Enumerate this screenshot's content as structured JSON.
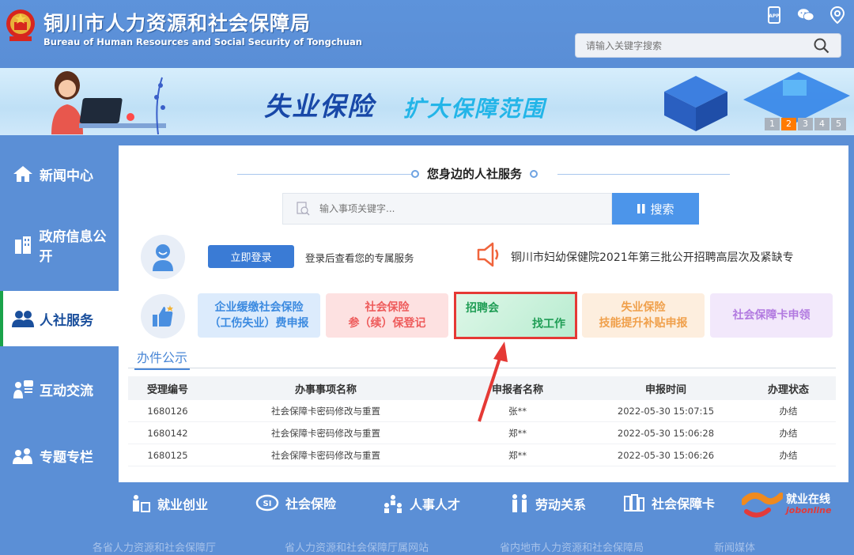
{
  "header": {
    "title": "铜川市人力资源和社会保障局",
    "subtitle": "Bureau of Human Resources and Social Security of Tongchuan",
    "icons": [
      "app-icon",
      "wechat-icon",
      "location-icon"
    ],
    "app_label": "APP",
    "search_placeholder": "请输入关键字搜索"
  },
  "banner": {
    "title": "失业保险",
    "subtitle": "扩大保障范围",
    "pages": [
      "1",
      "2",
      "3",
      "4",
      "5"
    ],
    "active_page": "2"
  },
  "sidebar": {
    "items": [
      {
        "label": "新闻中心",
        "icon": "home-icon"
      },
      {
        "label": "政府信息公开",
        "icon": "building-icon"
      },
      {
        "label": "人社服务",
        "icon": "people-icon"
      },
      {
        "label": "互动交流",
        "icon": "chat-person-icon"
      },
      {
        "label": "专题专栏",
        "icon": "group-icon"
      }
    ],
    "active": "人社服务"
  },
  "services": {
    "title": "您身边的人社服务",
    "search_placeholder": "输入事项关键字...",
    "search_button": "搜索",
    "login_button": "立即登录",
    "login_tip": "登录后查看您的专属服务",
    "notice": "铜川市妇幼保健院2021年第三批公开招聘高层次及紧缺专",
    "cards": [
      {
        "line1": "企业缓缴社会保险",
        "line2": "（工伤失业）费申报"
      },
      {
        "line1": "社会保险",
        "line2": "参（续）保登记"
      },
      {
        "line1": "招聘会",
        "line2": "找工作"
      },
      {
        "line1": "失业保险",
        "line2": "技能提升补贴申报"
      },
      {
        "line1": "社会保障卡申领",
        "line2": ""
      }
    ]
  },
  "public_list": {
    "title": "办件公示",
    "headers": [
      "受理编号",
      "办事事项名称",
      "申报者名称",
      "申报时间",
      "办理状态"
    ],
    "rows": [
      [
        "1680126",
        "社会保障卡密码修改与重置",
        "张**",
        "2022-05-30 15:07:15",
        "办结"
      ],
      [
        "1680142",
        "社会保障卡密码修改与重置",
        "郑**",
        "2022-05-30 15:06:28",
        "办结"
      ],
      [
        "1680125",
        "社会保障卡密码修改与重置",
        "郑**",
        "2022-05-30 15:06:26",
        "办结"
      ]
    ]
  },
  "bottom_nav": [
    {
      "label": "就业创业",
      "icon": "employment-icon"
    },
    {
      "label": "社会保险",
      "icon": "si-icon"
    },
    {
      "label": "人事人才",
      "icon": "personnel-icon"
    },
    {
      "label": "劳动关系",
      "icon": "labor-icon"
    },
    {
      "label": "社会保障卡",
      "icon": "card-icon"
    }
  ],
  "job_logo": {
    "title": "就业在线",
    "sub": "jobonline"
  },
  "footer_links": [
    "各省人力资源和社会保障厅",
    "省人力资源和社会保障厅属网站",
    "省内地市人力资源和社会保障局",
    "新闻媒体"
  ],
  "colors": {
    "accent": "#3a7bd5",
    "highlight": "#e53935",
    "active_page": "#ff7b00"
  }
}
